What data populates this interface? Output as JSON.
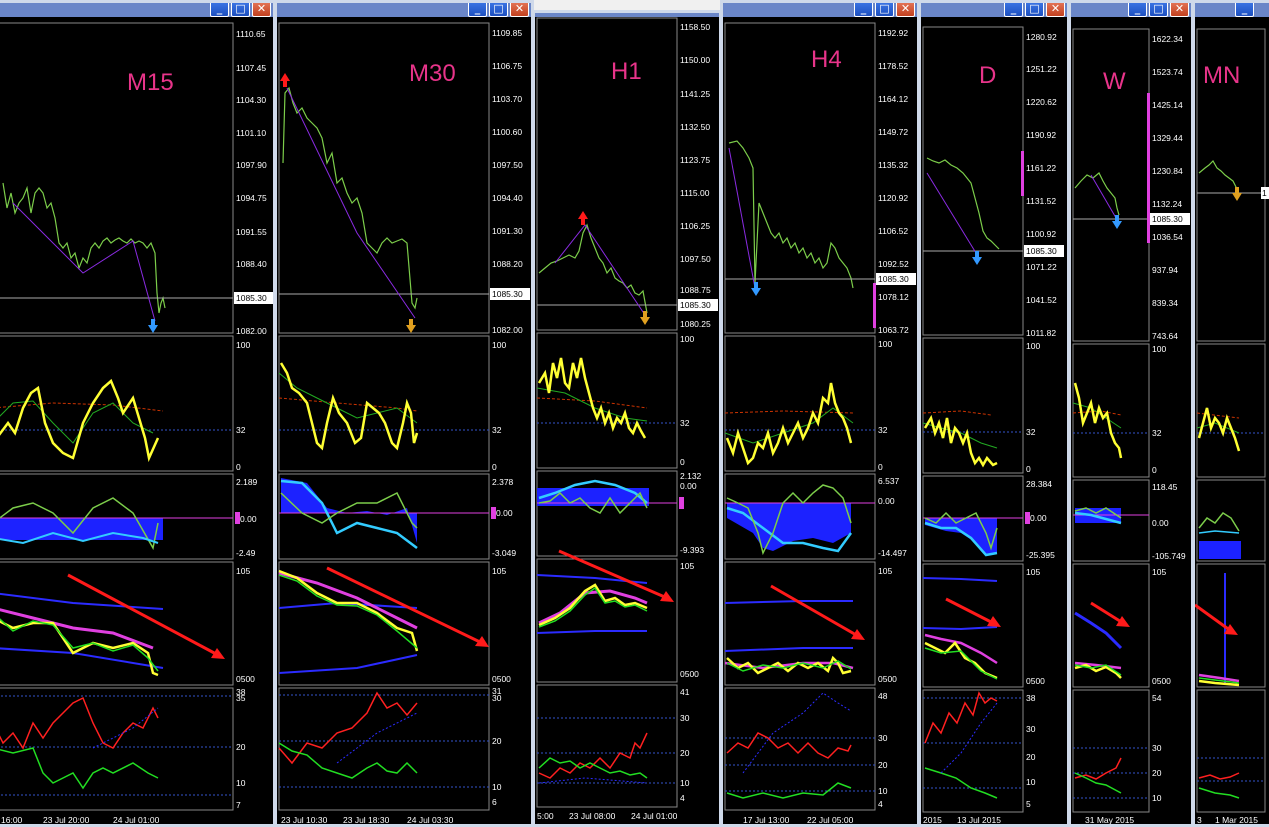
{
  "window_buttons": {
    "minimize": "_",
    "maximize": "□",
    "close": "✕"
  },
  "colors": {
    "price": "#7ccd4a",
    "label": "#e8348a",
    "arrow": "#ff1a1a",
    "up_arrow": "#3399ff",
    "orange_arrow": "#e0a020",
    "yellow": "#ffff33",
    "blue": "#2b2bff",
    "magenta": "#e040e0",
    "green": "#22dd22",
    "red": "#ff2020"
  },
  "windows": [
    {
      "id": "m15",
      "label": "M15",
      "current_price": "1085.30",
      "price_ticks": [
        "1110.65",
        "1107.45",
        "1104.30",
        "1101.10",
        "1097.90",
        "1094.75",
        "1091.55",
        "1088.40",
        "1082.00"
      ],
      "rsi_ticks": [
        "100",
        "32",
        "0"
      ],
      "macd_ticks": [
        "2.189",
        "0.00",
        "-2.49"
      ],
      "stoch_ticks": [
        "105",
        "0500"
      ],
      "adx_ticks": [
        "38",
        "35",
        "20",
        "10",
        "7"
      ],
      "time_ticks": [
        "16:00",
        "23 Jul 20:00",
        "24 Jul 01:00"
      ]
    },
    {
      "id": "m30",
      "label": "M30",
      "current_price": "1085.30",
      "price_ticks": [
        "1109.85",
        "1106.75",
        "1103.70",
        "1100.60",
        "1097.50",
        "1094.40",
        "1091.30",
        "1088.20",
        "1082.00"
      ],
      "rsi_ticks": [
        "100",
        "32",
        "0"
      ],
      "macd_ticks": [
        "2.378",
        "0.00",
        "-3.049"
      ],
      "stoch_ticks": [
        "105",
        "0500"
      ],
      "adx_ticks": [
        "31",
        "30",
        "20",
        "10",
        "6"
      ],
      "time_ticks": [
        "23 Jul 10:30",
        "23 Jul 18:30",
        "24 Jul 03:30"
      ]
    },
    {
      "id": "h1",
      "label": "H1",
      "current_price": "1085.30",
      "price_ticks": [
        "1158.50",
        "1150.00",
        "1141.25",
        "1132.50",
        "1123.75",
        "1115.00",
        "1106.25",
        "1097.50",
        "1088.75",
        "1080.25"
      ],
      "rsi_ticks": [
        "100",
        "32",
        "0"
      ],
      "macd_ticks": [
        "2.132",
        "0.00",
        "-9.393"
      ],
      "stoch_ticks": [
        "105",
        "0500"
      ],
      "adx_ticks": [
        "41",
        "30",
        "20",
        "10",
        "4"
      ],
      "time_ticks": [
        "5:00",
        "23 Jul 08:00",
        "24 Jul 01:00"
      ]
    },
    {
      "id": "h4",
      "label": "H4",
      "current_price": "1085.30",
      "price_ticks": [
        "1192.92",
        "1178.52",
        "1164.12",
        "1149.72",
        "1135.32",
        "1120.92",
        "1106.52",
        "1092.52",
        "1078.12",
        "1063.72"
      ],
      "rsi_ticks": [
        "100",
        "32",
        "0"
      ],
      "macd_ticks": [
        "6.537",
        "0.00",
        "-14.497"
      ],
      "stoch_ticks": [
        "105",
        "0500"
      ],
      "adx_ticks": [
        "48",
        "30",
        "20",
        "10",
        "4"
      ],
      "time_ticks": [
        "17 Jul 13:00",
        "22 Jul 05:00"
      ]
    },
    {
      "id": "d",
      "label": "D",
      "current_price": "1085.30",
      "price_ticks": [
        "1280.92",
        "1251.22",
        "1220.62",
        "1190.92",
        "1161.22",
        "1131.52",
        "1100.92",
        "1071.22",
        "1041.52",
        "1011.82"
      ],
      "rsi_ticks": [
        "100",
        "32",
        "0"
      ],
      "macd_ticks": [
        "28.384",
        "0.00",
        "-25.395"
      ],
      "stoch_ticks": [
        "105",
        "0500"
      ],
      "adx_ticks": [
        "38",
        "30",
        "20",
        "10",
        "5"
      ],
      "time_ticks": [
        "2015",
        "13 Jul 2015"
      ]
    },
    {
      "id": "w",
      "label": "W",
      "current_price": "1085.30",
      "price_ticks": [
        "1622.34",
        "1523.74",
        "1425.14",
        "1329.44",
        "1230.84",
        "1132.24",
        "1036.54",
        "937.94",
        "839.34",
        "743.64"
      ],
      "rsi_ticks": [
        "100",
        "32",
        "0"
      ],
      "macd_ticks": [
        "118.45",
        "0.00",
        "-105.749"
      ],
      "stoch_ticks": [
        "105",
        "0500"
      ],
      "adx_ticks": [
        "54",
        "30",
        "20",
        "10"
      ],
      "time_ticks": [
        "31 May 2015"
      ]
    },
    {
      "id": "mn",
      "label": "MN",
      "current_price": "1",
      "price_ticks": [],
      "rsi_ticks": [],
      "macd_ticks": [],
      "stoch_ticks": [],
      "adx_ticks": [],
      "time_ticks": [
        "3",
        "1 Mar 2015"
      ]
    }
  ]
}
